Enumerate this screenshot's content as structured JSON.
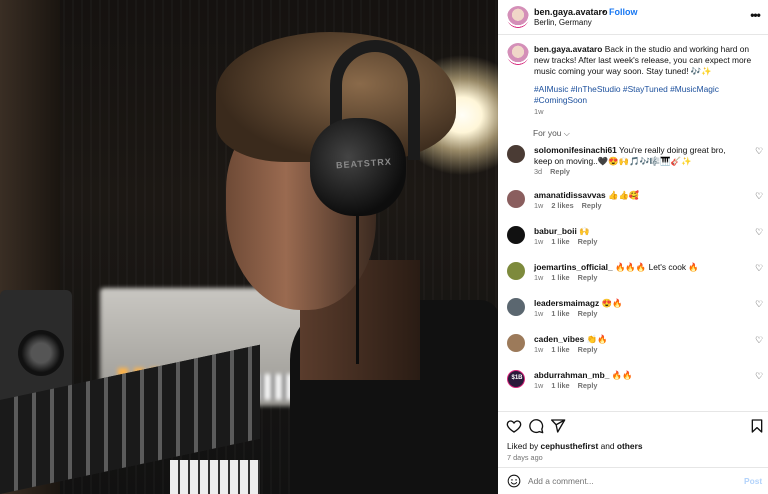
{
  "post": {
    "username": "ben.gaya.avataro",
    "separator": "•",
    "follow_label": "Follow",
    "location": "Berlin, Germany",
    "more_icon": "more-horizontal-icon",
    "caption_user": "ben.gaya.avataro",
    "caption": "Back in the studio and working hard on new tracks! After last week's release, you can expect more music coming your way soon. Stay tuned! 🎶✨",
    "hashtags": "#AIMusic #InTheStudio #StayTuned #MusicMagic #ComingSoon",
    "caption_time": "1w",
    "for_you_label": "For you",
    "headphone_brand": "BEATSTRX"
  },
  "comments": [
    {
      "user": "solomonifesinachi61",
      "text": "You're really doing great bro, keep on moving..🖤😍🙌🎵🎶🎼🎹🎸✨",
      "time": "3d",
      "likes": "",
      "reply": "Reply",
      "avatar_color": "#4a3b34"
    },
    {
      "user": "amanatidissavvas",
      "text": "👍👍🥰",
      "time": "1w",
      "likes": "2 likes",
      "reply": "Reply",
      "avatar_color": "#8a5e5e"
    },
    {
      "user": "babur_boii",
      "text": "🙌",
      "time": "1w",
      "likes": "1 like",
      "reply": "Reply",
      "avatar_color": "#111111"
    },
    {
      "user": "joemartins_official_",
      "text": "🔥🔥🔥 Let's cook 🔥",
      "time": "1w",
      "likes": "1 like",
      "reply": "Reply",
      "avatar_color": "#7d8a3c"
    },
    {
      "user": "leadersmaimagz",
      "text": "😍🔥",
      "time": "1w",
      "likes": "1 like",
      "reply": "Reply",
      "avatar_color": "#5b6770"
    },
    {
      "user": "caden_vibes",
      "text": "👏🔥",
      "time": "1w",
      "likes": "1 like",
      "reply": "Reply",
      "avatar_color": "#9c7a5a"
    },
    {
      "user": "abdurrahman_mb_",
      "text": "🔥🔥",
      "time": "1w",
      "likes": "1 like",
      "reply": "Reply",
      "avatar_color": "#2a1a3a",
      "avatar_text": "$1B"
    }
  ],
  "actions": {
    "like_icon": "heart-outline-icon",
    "comment_icon": "comment-bubble-icon",
    "share_icon": "paper-plane-icon",
    "save_icon": "bookmark-icon"
  },
  "likes": {
    "prefix": "Liked by",
    "first_user": "cephusthefirst",
    "connector": "and",
    "others": "others"
  },
  "post_date": "7 days ago",
  "add_comment": {
    "placeholder": "Add a comment...",
    "post_label": "Post",
    "emoji_icon": "smiley-icon"
  },
  "colors": {
    "link_blue": "#1877f2",
    "hashtag_blue": "#1b4f9c",
    "post_disabled": "#b3d3fb",
    "muted": "#737373"
  }
}
